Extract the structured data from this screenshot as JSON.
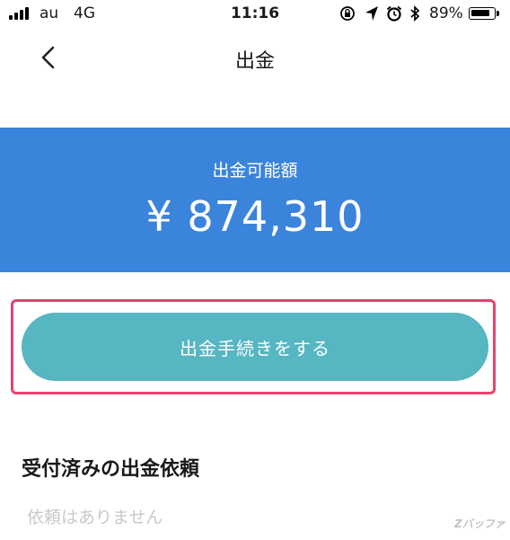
{
  "status_bar": {
    "carrier": "au",
    "network": "4G",
    "time": "11:16",
    "battery_percent": "89%",
    "battery_level": 0.89,
    "icons": [
      "rotation-lock-icon",
      "location-arrow-icon",
      "alarm-icon",
      "bluetooth-icon"
    ]
  },
  "nav": {
    "title": "出金",
    "back_icon": "chevron-left-icon"
  },
  "balance": {
    "label": "出金可能額",
    "amount": "¥ 874,310",
    "background_color": "#3b84dc"
  },
  "withdraw_button": {
    "label": "出金手続きをする",
    "color": "#56b6c2",
    "highlight_color": "#e8436f"
  },
  "requests": {
    "title": "受付済みの出金依頼",
    "empty_text": "依頼はありません"
  },
  "watermark": "Zバッファ"
}
